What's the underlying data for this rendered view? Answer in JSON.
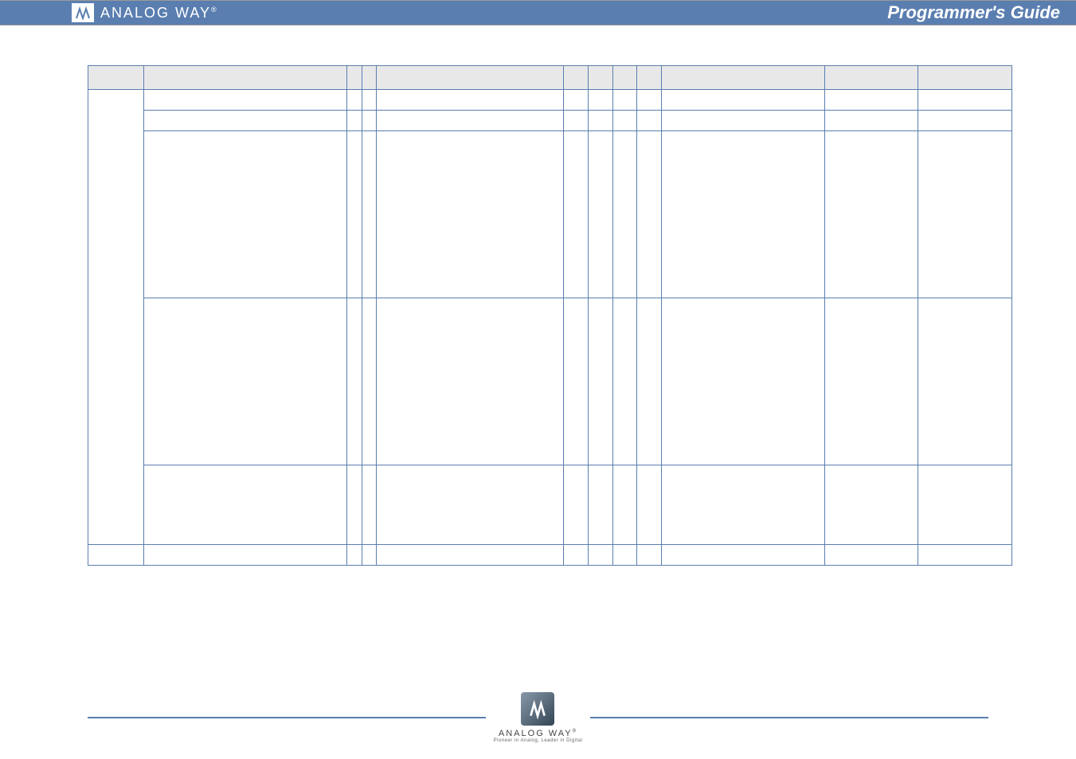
{
  "header": {
    "brand": "ANALOG WAY",
    "title": "Programmer's Guide"
  },
  "table": {
    "headers": [
      "",
      "",
      "",
      "",
      "",
      "",
      "",
      "",
      "",
      "",
      "",
      ""
    ],
    "rows": [
      {
        "cells": [
          "",
          "",
          "",
          "",
          "",
          "",
          "",
          "",
          "",
          "",
          "",
          ""
        ]
      },
      {
        "cells": [
          "",
          "",
          "",
          "",
          "",
          "",
          "",
          "",
          "",
          "",
          "",
          ""
        ]
      },
      {
        "cells": [
          "",
          "",
          "",
          "",
          "",
          "",
          "",
          "",
          "",
          "",
          "",
          ""
        ]
      },
      {
        "cells": [
          "",
          "",
          "",
          "",
          "",
          "",
          "",
          "",
          "",
          "",
          "",
          ""
        ]
      },
      {
        "cells": [
          "",
          "",
          "",
          "",
          "",
          "",
          "",
          "",
          "",
          "",
          "",
          ""
        ]
      },
      {
        "cells": [
          "",
          "",
          "",
          "",
          "",
          "",
          "",
          "",
          "",
          "",
          "",
          ""
        ]
      }
    ]
  },
  "footer": {
    "brand": "ANALOG WAY",
    "tagline": "Pioneer in Analog, Leader in Digital"
  }
}
